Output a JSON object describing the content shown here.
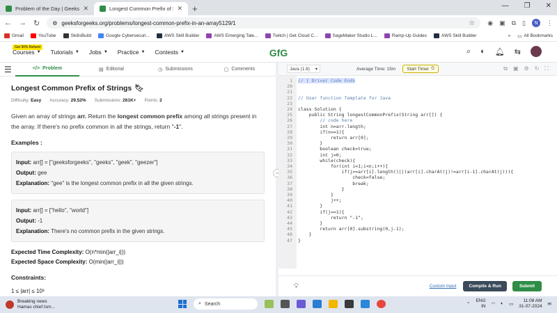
{
  "browser": {
    "tabs": [
      {
        "title": "Problem of the Day | GeeksforGeeks",
        "active": false
      },
      {
        "title": "Longest Common Prefix of Strings",
        "active": true
      }
    ],
    "new_tab_glyph": "+",
    "url": "geeksforgeeks.org/problems/longest-common-prefix-in-an-array5129/1",
    "profile_initial": "N",
    "bookmarks": [
      {
        "label": "Gmail",
        "color": "#d93025"
      },
      {
        "label": "YouTube",
        "color": "#ff0000"
      },
      {
        "label": "SkillsBuild",
        "color": "#333333"
      },
      {
        "label": "Google Cybersecuri...",
        "color": "#4285f4"
      },
      {
        "label": "AWS Skill Builder",
        "color": "#232f3e"
      },
      {
        "label": "AWS Emerging Tale...",
        "color": "#8e44ad"
      },
      {
        "label": "Twitch | Get Cloud C...",
        "color": "#8e44ad"
      },
      {
        "label": "SageMaker Studio L...",
        "color": "#8e44ad"
      },
      {
        "label": "Ramp-Up Guides",
        "color": "#8e44ad"
      },
      {
        "label": "AWS Skill Builder",
        "color": "#232f3e"
      }
    ],
    "all_bookmarks": "All Bookmarks"
  },
  "site": {
    "promo": "Get 90% Refund",
    "nav": [
      "Courses",
      "Tutorials",
      "Jobs",
      "Practice",
      "Contests"
    ],
    "logo_text": "GfG",
    "brand_color": "#2f8d46"
  },
  "problem": {
    "tabs": [
      "Problem",
      "Editorial",
      "Submissions",
      "Comments"
    ],
    "title": "Longest Common Prefix of Strings",
    "meta": {
      "difficulty_label": "Difficulty:",
      "difficulty": "Easy",
      "accuracy_label": "Accuracy:",
      "accuracy": "29.52%",
      "submissions_label": "Submissions:",
      "submissions": "261K+",
      "points_label": "Points:",
      "points": "2"
    },
    "desc": {
      "p1": "Given an array of strings ",
      "arr": "arr.",
      "p2": " Return the ",
      "bold": "longest common prefix",
      "p3": " among all strings present in the array. If there's no prefix common in all the strings, return \"",
      "ret": "-1",
      "p4": "\"."
    },
    "examples_heading": "Examples :",
    "labels": {
      "input": "Input:",
      "output": "Output:",
      "explanation": "Explanation:"
    },
    "examples": [
      {
        "input": "arr[] = [\"geeksforgeeks\", \"geeks\", \"geek\", \"geezer\"]",
        "output": "gee",
        "explanation": "\"gee\" is the longest common prefix in all the given strings."
      },
      {
        "input": "arr[] = [\"hello\", \"world\"]",
        "output": "-1",
        "explanation": "There's no common prefix in the given strings."
      }
    ],
    "etc_label": "Expected Time Complexity:",
    "etc": "O(n*min(|arr_i|))",
    "esc_label": "Expected Space Complexity:",
    "esc": "O(min(|arr_i|))",
    "constraints_heading": "Constraints:",
    "constraint": "1 ≤ |arr| ≤ 10³"
  },
  "editor": {
    "language": "Java (1.8)",
    "avg_time": "Average Time: 15m",
    "timer_label": "Start Timer",
    "lines": [
      {
        "n": "1",
        "t": "// } Driver Code Ends",
        "cls": "cm",
        "hl": true
      },
      {
        "n": "20",
        "t": ""
      },
      {
        "n": "21",
        "t": ""
      },
      {
        "n": "22",
        "t": "// User function Template for Java",
        "cls": "cm"
      },
      {
        "n": "23",
        "t": ""
      },
      {
        "n": "24",
        "t": "class Solution {"
      },
      {
        "n": "25",
        "t": "    public String longestCommonPrefix(String arr[]) {"
      },
      {
        "n": "26",
        "t": "        // code here",
        "cls": "cm"
      },
      {
        "n": "27",
        "t": "        int n=arr.length;"
      },
      {
        "n": "28",
        "t": "        if(n==1){"
      },
      {
        "n": "29",
        "t": "            return arr[0];"
      },
      {
        "n": "30",
        "t": "        }"
      },
      {
        "n": "31",
        "t": "        boolean check=true;"
      },
      {
        "n": "32",
        "t": "        int j=0;"
      },
      {
        "n": "33",
        "t": "        while(check){"
      },
      {
        "n": "34",
        "t": "            for(int i=1;i<n;i++){"
      },
      {
        "n": "35",
        "t": "                if(j>=arr[i].length()||(arr[i].charAt(j)!=arr[i-1].charAt(j))){"
      },
      {
        "n": "36",
        "t": "                    check=false;"
      },
      {
        "n": "37",
        "t": "                    break;"
      },
      {
        "n": "38",
        "t": "                }"
      },
      {
        "n": "39",
        "t": "            }"
      },
      {
        "n": "40",
        "t": "            j++;"
      },
      {
        "n": "41",
        "t": "        }"
      },
      {
        "n": "42",
        "t": "        if(j==1){"
      },
      {
        "n": "43",
        "t": "            return \"-1\";"
      },
      {
        "n": "44",
        "t": "        }"
      },
      {
        "n": "45",
        "t": "        return arr[0].substring(0,j-1);"
      },
      {
        "n": "46",
        "t": "    }"
      },
      {
        "n": "47",
        "t": "}"
      }
    ],
    "custom_input": "Custom Input",
    "compile_run": "Compile & Run",
    "submit": "Submit"
  },
  "taskbar": {
    "news_title": "Breaking news",
    "news_sub": "Hamas chief Ism...",
    "search": "Search",
    "lang": "ENG",
    "region": "IN",
    "time": "11:08 AM",
    "date": "31-07-2024"
  }
}
